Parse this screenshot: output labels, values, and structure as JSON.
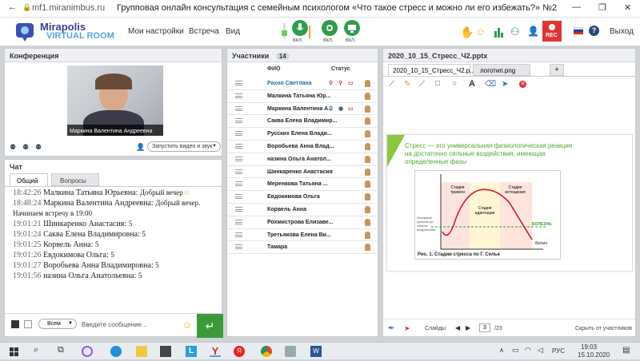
{
  "browser": {
    "address": "mf1.miranimbus.ru",
    "title": "Групповая онлайн консультация с семейным психологом «Что такое стресс и можно ли его избежать?» №2"
  },
  "header": {
    "logo_title": "Mirapolis",
    "logo_sub": "VIRTUAL ROOM",
    "menu": [
      "Мои настройки",
      "Встреча",
      "Вид"
    ],
    "mic_label": "вкл.",
    "cam_label": "вкл.",
    "screen_label": "вкл.",
    "rec_label": "REC",
    "exit_label": "Выход"
  },
  "conference": {
    "title": "Конференция",
    "video_name": "Маркина Валентина Андреевна",
    "start_video_label": "Запустить видео и звук"
  },
  "chat": {
    "title": "Чат",
    "tabs": [
      "Общий",
      "Вопросы"
    ],
    "messages": [
      {
        "time": "18:42:26",
        "author": "Малкина Татьяна Юрьевна:",
        "text": "Добрый вечер"
      },
      {
        "time": "18:48:24",
        "author": "Маркина Валентина Андреевна:",
        "text": "Добрый вечер. Начинаем встречу в 19:00"
      },
      {
        "time": "19:01:21",
        "author": "Шинкаренко Анастасия:",
        "text": "5"
      },
      {
        "time": "19:01:24",
        "author": "Саква Елена Владимировна:",
        "text": "5"
      },
      {
        "time": "19:01:25",
        "author": "Корвель Анна:",
        "text": "5"
      },
      {
        "time": "19:01:26",
        "author": "Евдокимова Ольга:",
        "text": "5"
      },
      {
        "time": "19:01:27",
        "author": "Воробьева Анна Владимировна:",
        "text": "5"
      },
      {
        "time": "19:01:56",
        "author": "назина Ольга Анатольевна:",
        "text": "5"
      }
    ],
    "recipient": "Всем",
    "input_placeholder": "Введите сообщение..."
  },
  "participants": {
    "title": "Участники",
    "count": "14",
    "col_name": "ФИО",
    "col_status": "Статус",
    "rows": [
      "Рахно Светлана",
      "Малкина Татьяна Юр...",
      "Маркина Валентина А...",
      "Саква Елена Владимир...",
      "Русских Елена Влади...",
      "Воробьева Анна Влад...",
      "назина Ольга Анатол...",
      "Шинкаренко Анастасия",
      "Меренкова Татьяна ...",
      "Евдокимова Ольга",
      "Корвель Анна",
      "Рохмистрова Елизаве...",
      "Третьякова Елена Ви...",
      "Тамара"
    ]
  },
  "presentation": {
    "title": "2020_10_15_Стресс_Ч2.pptx",
    "tabs": [
      "2020_10_15_Стресс_Ч2.p...",
      "логотип.png",
      "+"
    ],
    "slide_text": "Стресс — это универсальная физиологическая реакция на достаточно сильные воздействия, имеющая определенные фазы",
    "stages": [
      "Стадия тревоги",
      "Стадия адаптации",
      "Стадия истощения"
    ],
    "level_label": "Исходный уровень до начала воздействия",
    "disease_label": "БОЛЕЗНЬ",
    "time_label": "Время",
    "caption": "Рис. 1. Стадии стресса по Г. Селье",
    "slides_label": "Слайды",
    "page": "3",
    "total": "/23",
    "hide_label": "Скрыть от участников"
  },
  "accent": "#4fa7dc",
  "taskbar": {
    "lang": "РУС",
    "time": "19:03",
    "date": "15.10.2020"
  }
}
